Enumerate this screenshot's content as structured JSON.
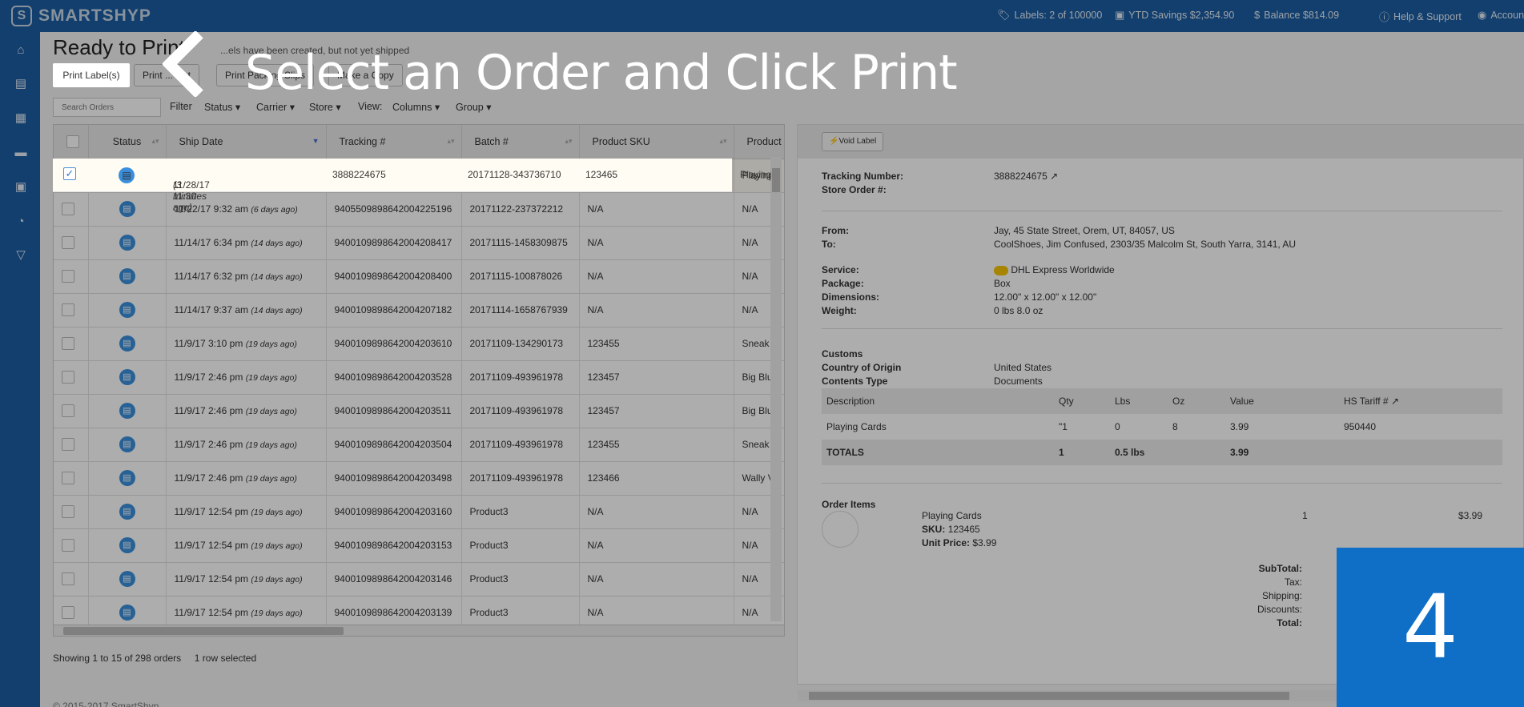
{
  "brand": {
    "name": "SMARTSHYP"
  },
  "topbar": {
    "labels": "Labels: 2 of 100000",
    "ytd": "YTD Savings $2,354.90",
    "balance": "Balance $814.09",
    "help": "Help & Support",
    "account": "Accoun"
  },
  "sidebar": [
    "home-icon",
    "basket-icon",
    "calendar-icon",
    "truck-icon",
    "address-book-icon",
    "pie-chart-icon",
    "cart-icon"
  ],
  "page": {
    "title": "Ready to Print",
    "subtitle": "...els have been created, but not yet shipped"
  },
  "toolbar": {
    "print_labels": "Print Label(s)",
    "print_list": "Print ... List",
    "print_packing": "Print Packing Slips",
    "make_copy": "Make a Copy"
  },
  "search": {
    "placeholder": "Search Orders"
  },
  "filters": {
    "filter": "Filter",
    "status": "Status",
    "carrier": "Carrier",
    "store": "Store",
    "view": "View:",
    "columns": "Columns",
    "group": "Group"
  },
  "table": {
    "headers": {
      "status": "Status",
      "ship_date": "Ship Date",
      "tracking": "Tracking #",
      "batch": "Batch #",
      "sku": "Product SKU",
      "product": "Product"
    },
    "rows": [
      {
        "date": "11/28/17 11:30 am",
        "ago": "(3 minutes ago)",
        "tracking": "3888224675",
        "batch": "20171128-343736710",
        "sku": "123465",
        "product": "Playing",
        "selected": true
      },
      {
        "date": "11/22/17 9:32 am",
        "ago": "(6 days ago)",
        "tracking": "9405509898642004225196",
        "batch": "20171122-237372212",
        "sku": "N/A",
        "product": "N/A"
      },
      {
        "date": "11/14/17 6:34 pm",
        "ago": "(14 days ago)",
        "tracking": "9400109898642004208417",
        "batch": "20171115-1458309875",
        "sku": "N/A",
        "product": "N/A"
      },
      {
        "date": "11/14/17 6:32 pm",
        "ago": "(14 days ago)",
        "tracking": "9400109898642004208400",
        "batch": "20171115-100878026",
        "sku": "N/A",
        "product": "N/A"
      },
      {
        "date": "11/14/17 9:37 am",
        "ago": "(14 days ago)",
        "tracking": "9400109898642004207182",
        "batch": "20171114-1658767939",
        "sku": "N/A",
        "product": "N/A"
      },
      {
        "date": "11/9/17 3:10 pm",
        "ago": "(19 days ago)",
        "tracking": "9400109898642004203610",
        "batch": "20171109-134290173",
        "sku": "123455",
        "product": "Sneak"
      },
      {
        "date": "11/9/17 2:46 pm",
        "ago": "(19 days ago)",
        "tracking": "9400109898642004203528",
        "batch": "20171109-493961978",
        "sku": "123457",
        "product": "Big Blu"
      },
      {
        "date": "11/9/17 2:46 pm",
        "ago": "(19 days ago)",
        "tracking": "9400109898642004203511",
        "batch": "20171109-493961978",
        "sku": "123457",
        "product": "Big Blu"
      },
      {
        "date": "11/9/17 2:46 pm",
        "ago": "(19 days ago)",
        "tracking": "9400109898642004203504",
        "batch": "20171109-493961978",
        "sku": "123455",
        "product": "Sneak"
      },
      {
        "date": "11/9/17 2:46 pm",
        "ago": "(19 days ago)",
        "tracking": "9400109898642004203498",
        "batch": "20171109-493961978",
        "sku": "123466",
        "product": "Wally V"
      },
      {
        "date": "11/9/17 12:54 pm",
        "ago": "(19 days ago)",
        "tracking": "9400109898642004203160",
        "batch": "Product3",
        "sku": "N/A",
        "product": "N/A"
      },
      {
        "date": "11/9/17 12:54 pm",
        "ago": "(19 days ago)",
        "tracking": "9400109898642004203153",
        "batch": "Product3",
        "sku": "N/A",
        "product": "N/A"
      },
      {
        "date": "11/9/17 12:54 pm",
        "ago": "(19 days ago)",
        "tracking": "9400109898642004203146",
        "batch": "Product3",
        "sku": "N/A",
        "product": "N/A"
      },
      {
        "date": "11/9/17 12:54 pm",
        "ago": "(19 days ago)",
        "tracking": "9400109898642004203139",
        "batch": "Product3",
        "sku": "N/A",
        "product": "N/A"
      }
    ]
  },
  "table_footer": {
    "showing": "Showing 1 to 15 of 298 orders",
    "selected": "1 row selected"
  },
  "copyright": "© 2015-2017 SmartShyp",
  "detail": {
    "void_label": "Void Label",
    "tracking_label": "Tracking Number:",
    "tracking_value": "3888224675",
    "store_order_label": "Store Order #:",
    "from_label": "From:",
    "from_value": "Jay, 45 State Street, Orem, UT, 84057, US",
    "to_label": "To:",
    "to_value": "CoolShoes, Jim Confused, 2303/35 Malcolm St, South Yarra, 3141, AU",
    "service_label": "Service:",
    "service_value": "DHL Express Worldwide",
    "package_label": "Package:",
    "package_value": "Box",
    "dimensions_label": "Dimensions:",
    "dimensions_value": "12.00\" x 12.00\" x 12.00\"",
    "weight_label": "Weight:",
    "weight_value": "0 lbs 8.0 oz",
    "customs_label": "Customs",
    "origin_label": "Country of Origin",
    "origin_value": "United States",
    "contents_label": "Contents Type",
    "contents_value": "Documents",
    "customs_headers": [
      "Description",
      "Qty",
      "Lbs",
      "Oz",
      "Value",
      "HS Tariff #"
    ],
    "customs_row": [
      "Playing Cards",
      "\"1",
      "0",
      "8",
      "3.99",
      "950440"
    ],
    "customs_total": [
      "TOTALS",
      "1",
      "0.5 lbs",
      "",
      "3.99",
      ""
    ],
    "order_items_label": "Order Items",
    "item_name": "Playing Cards",
    "item_sku_label": "SKU:",
    "item_sku": "123465",
    "item_price_label": "Unit Price:",
    "item_price": "$3.99",
    "item_qty": "1",
    "item_total": "$3.99",
    "subtotal_label": "SubTotal:",
    "tax_label": "Tax:",
    "shipping_label": "Shipping:",
    "discounts_label": "Discounts:",
    "total_label": "Total:"
  },
  "tutorial": {
    "instruction": "Select an Order and Click Print",
    "step": "4"
  }
}
